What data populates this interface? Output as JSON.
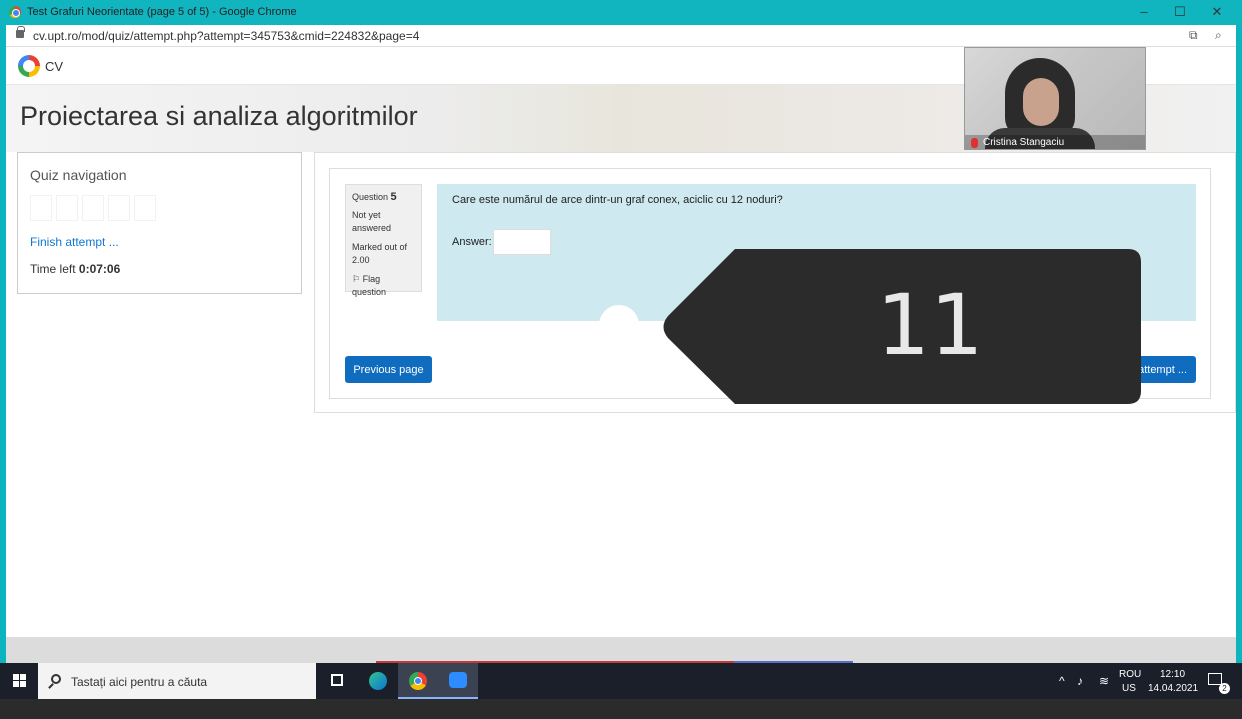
{
  "window": {
    "title": "Test Grafuri Neorientate (page 5 of 5) - Google Chrome",
    "controls": {
      "minimize": "–",
      "maximize": "☐",
      "close": "✕"
    }
  },
  "address_bar": {
    "url": "cv.upt.ro/mod/quiz/attempt.php?attempt=345753&cmid=224832&page=4"
  },
  "site": {
    "logo_text": "CV",
    "course_title": "Proiectarea si analiza algoritmilor"
  },
  "quiz_navigation": {
    "heading": "Quiz navigation",
    "finish_link": "Finish attempt ...",
    "time_left_label": "Time left",
    "time_left_value": "0:07:06"
  },
  "question": {
    "label": "Question",
    "number": "5",
    "status": "Not yet answered",
    "marks": "Marked out of 2.00",
    "flag_label": "Flag question",
    "text": "Care este numărul de arce dintr-un graf conex, aciclic cu 12 noduri?",
    "answer_label": "Answer:",
    "answer_value": ""
  },
  "buttons": {
    "previous": "Previous page",
    "finish": "Finish attempt ..."
  },
  "overlay": {
    "number": "11"
  },
  "webcam": {
    "participant_name": "Cristina Stangaciu"
  },
  "taskbar": {
    "search_placeholder": "Tastați aici pentru a căuta",
    "lang_top": "ROU",
    "lang_bottom": "US",
    "time": "12:10",
    "date": "14.04.2021",
    "notification_count": "2"
  }
}
